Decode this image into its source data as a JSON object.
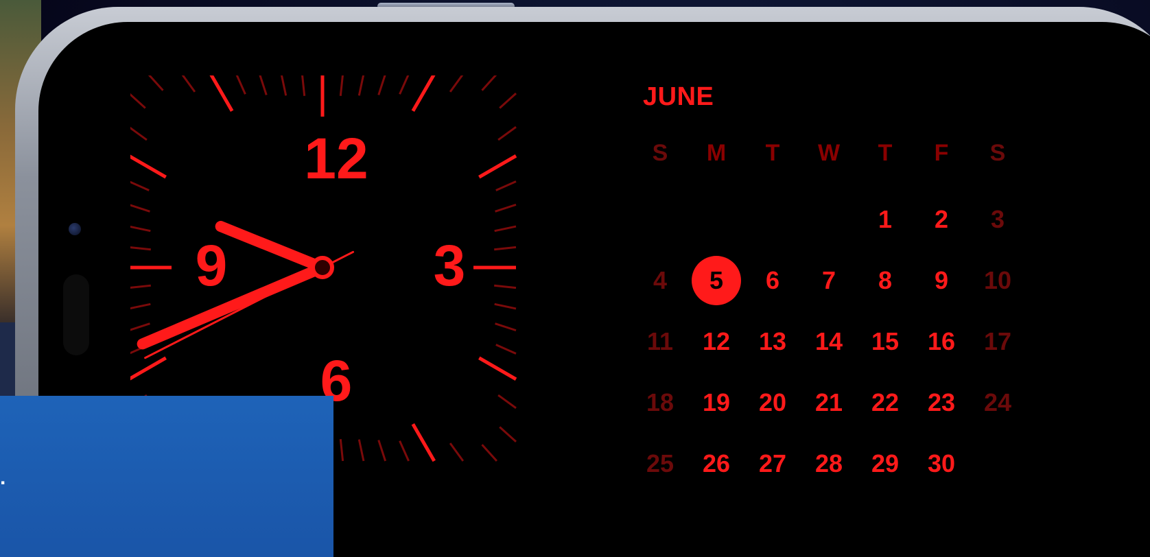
{
  "clock": {
    "numerals": [
      "12",
      "3",
      "6",
      "9"
    ],
    "accent_color": "#ff1a1a",
    "hour_hand_degrees": 292,
    "minute_hand_degrees": 247,
    "second_hand_degrees": 243
  },
  "calendar": {
    "month": "JUNE",
    "weekday_headers": [
      "S",
      "M",
      "T",
      "W",
      "T",
      "F",
      "S"
    ],
    "weeks": [
      [
        "",
        "",
        "",
        "",
        "1",
        "2",
        "3"
      ],
      [
        "4",
        "5",
        "6",
        "7",
        "8",
        "9",
        "10"
      ],
      [
        "11",
        "12",
        "13",
        "14",
        "15",
        "16",
        "17"
      ],
      [
        "18",
        "19",
        "20",
        "21",
        "22",
        "23",
        "24"
      ],
      [
        "25",
        "26",
        "27",
        "28",
        "29",
        "30",
        ""
      ]
    ],
    "today": "5",
    "accent_color": "#ff1a1a",
    "weekday_color": "#ff1a1a",
    "weekend_color": "#6b0a0a"
  },
  "overlay": {
    "text": ".",
    "color": "#1e63b8"
  }
}
